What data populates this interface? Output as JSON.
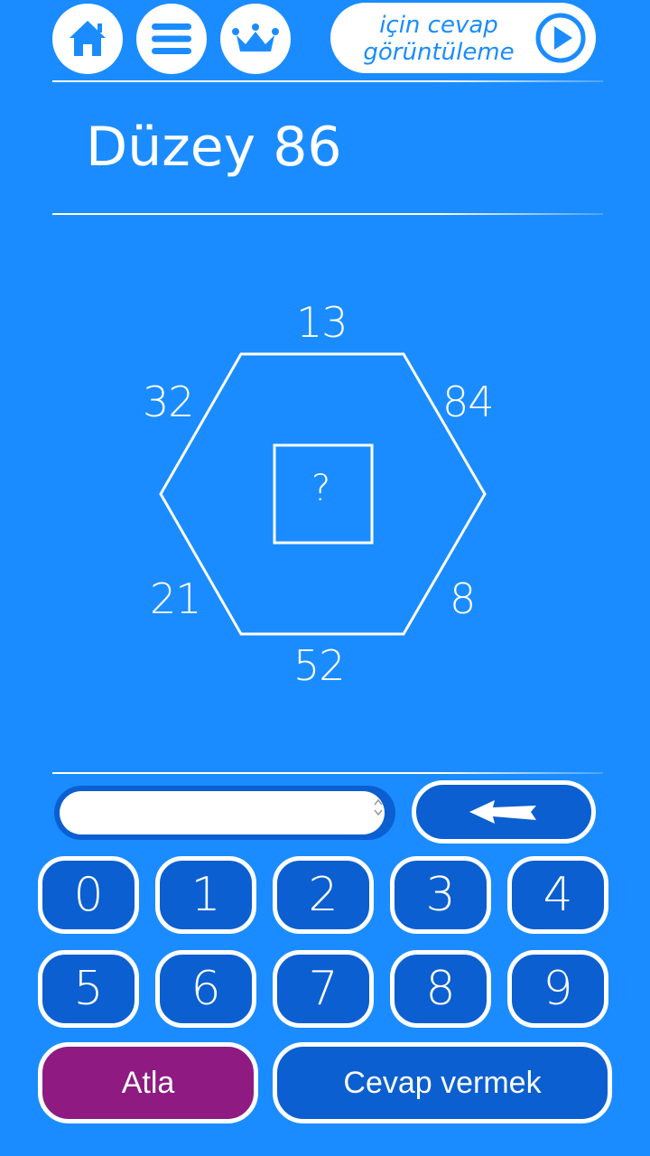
{
  "header": {
    "home_icon": "home-icon",
    "menu_icon": "menu-icon",
    "crown_icon": "crown-icon",
    "hint_line1": "için cevap",
    "hint_line2": "görüntüleme",
    "play_icon": "play-icon"
  },
  "level": {
    "title": "Düzey 86"
  },
  "puzzle": {
    "top": "13",
    "upper_left": "32",
    "upper_right": "84",
    "lower_left": "21",
    "lower_right": "8",
    "bottom": "52",
    "center": "?"
  },
  "input": {
    "value": "",
    "placeholder": ""
  },
  "keypad": {
    "backspace_icon": "back-arrow-icon",
    "keys": [
      "0",
      "1",
      "2",
      "3",
      "4",
      "5",
      "6",
      "7",
      "8",
      "9"
    ]
  },
  "actions": {
    "skip": "Atla",
    "submit": "Cevap vermek"
  },
  "colors": {
    "background": "#1a8cff",
    "key_fill": "#0b5fd0",
    "skip_fill": "#8e1a82",
    "white": "#ffffff"
  }
}
